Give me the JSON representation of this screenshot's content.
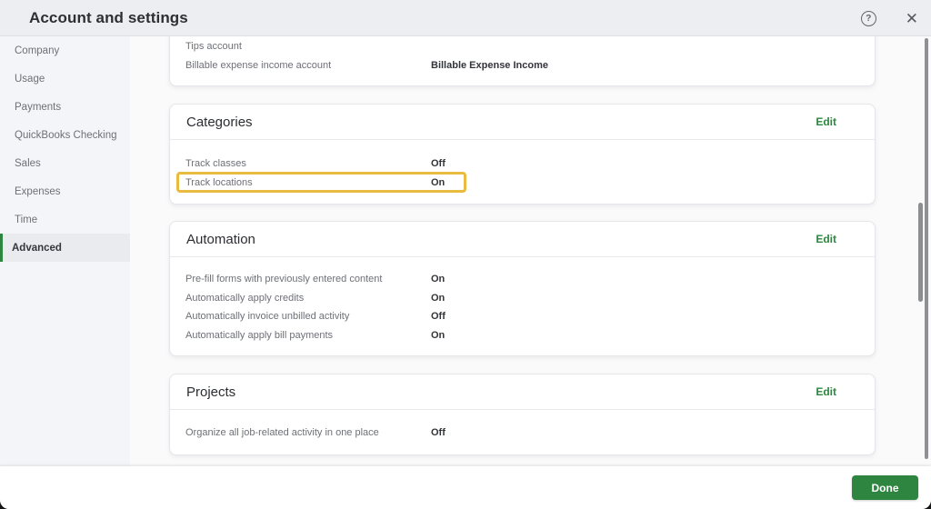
{
  "window": {
    "title": "Account and settings",
    "help_icon_glyph": "?",
    "close_icon_glyph": "✕"
  },
  "sidebar": {
    "items": [
      {
        "label": "Company",
        "selected": false
      },
      {
        "label": "Usage",
        "selected": false
      },
      {
        "label": "Payments",
        "selected": false
      },
      {
        "label": "QuickBooks Checking",
        "selected": false
      },
      {
        "label": "Sales",
        "selected": false
      },
      {
        "label": "Expenses",
        "selected": false
      },
      {
        "label": "Time",
        "selected": false
      },
      {
        "label": "Advanced",
        "selected": true
      }
    ]
  },
  "content": {
    "cards": [
      {
        "title": "",
        "edit_label": "",
        "rows": [
          {
            "label": "Tips account",
            "value": ""
          },
          {
            "label": "Billable expense income account",
            "value": "Billable Expense Income"
          }
        ]
      },
      {
        "title": "Categories",
        "edit_label": "Edit",
        "rows": [
          {
            "label": "Track classes",
            "value": "Off",
            "highlighted": false
          },
          {
            "label": "Track locations",
            "value": "On",
            "highlighted": true
          }
        ]
      },
      {
        "title": "Automation",
        "edit_label": "Edit",
        "rows": [
          {
            "label": "Pre-fill forms with previously entered content",
            "value": "On"
          },
          {
            "label": "Automatically apply credits",
            "value": "On"
          },
          {
            "label": "Automatically invoice unbilled activity",
            "value": "Off"
          },
          {
            "label": "Automatically apply bill payments",
            "value": "On"
          }
        ]
      },
      {
        "title": "Projects",
        "edit_label": "Edit",
        "rows": [
          {
            "label": "Organize all job-related activity in one place",
            "value": "Off"
          }
        ]
      }
    ]
  },
  "footer": {
    "done_label": "Done"
  },
  "colors": {
    "accent_green": "#2e8540",
    "highlight_yellow": "#e9bc3f",
    "header_bg": "#eceef1",
    "sidebar_bg": "#f4f5f8"
  }
}
